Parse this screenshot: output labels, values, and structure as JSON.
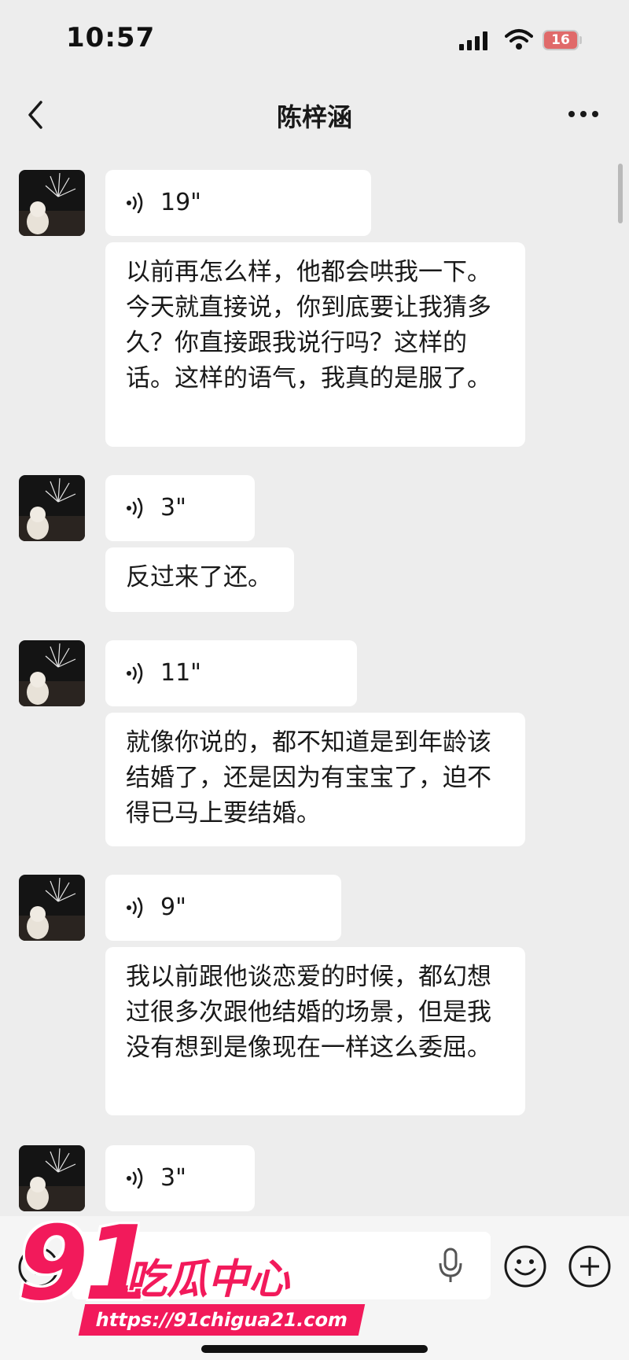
{
  "status_bar": {
    "time": "10:57",
    "battery": "16"
  },
  "header": {
    "title": "陈梓涵"
  },
  "messages": [
    {
      "voice_duration": "19\"",
      "text": "以前再怎么样，他都会哄我一下。今天就直接说，你到底要让我猜多久？你直接跟我说行吗？这样的话。这样的语气，我真的是服了。"
    },
    {
      "voice_duration": "3\"",
      "text": "反过来了还。"
    },
    {
      "voice_duration": "11\"",
      "text": "就像你说的，都不知道是到年龄该结婚了，还是因为有宝宝了，迫不得已马上要结婚。"
    },
    {
      "voice_duration": "9\"",
      "text": "我以前跟他谈恋爱的时候，都幻想过很多次跟他结婚的场景，但是我没有想到是像现在一样这么委屈。"
    },
    {
      "voice_duration": "3\""
    }
  ],
  "watermark": {
    "logo_number": "91",
    "logo_text": "吃瓜中心",
    "url": "https://91chigua21.com"
  },
  "icons": {
    "back": "chevron-left-icon",
    "more": "more-dots-icon",
    "voice": "voice-wave-icon",
    "mic": "microphone-icon",
    "emoji": "emoji-icon",
    "plus": "plus-icon"
  },
  "colors": {
    "background": "#ededed",
    "bubble": "#ffffff",
    "text": "#191919",
    "watermark": "#f21a5b"
  }
}
